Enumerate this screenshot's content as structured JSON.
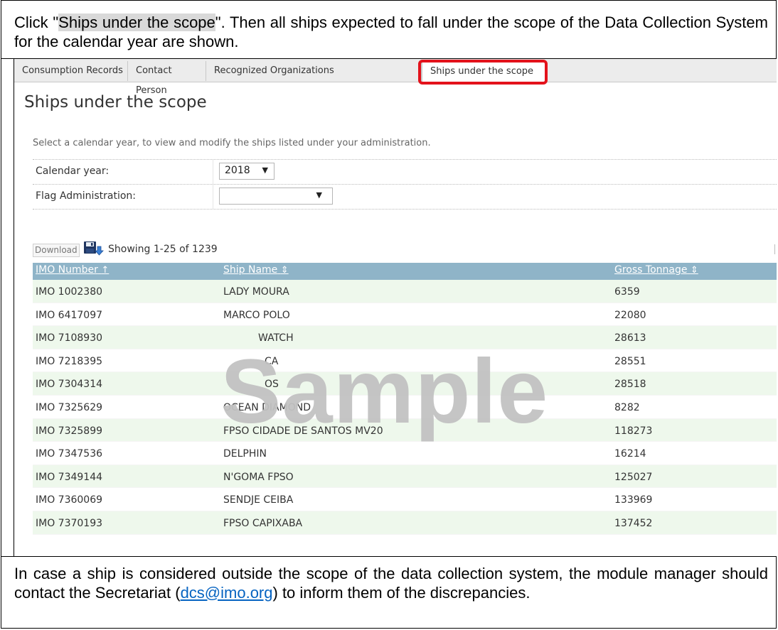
{
  "intro": {
    "prefix": "Click \"",
    "highlight": "Ships under the scope",
    "suffix": "\". Then all ships expected to fall under the scope of the Data Collection System for the calendar year are shown."
  },
  "tabs": [
    {
      "label": "Consumption Records"
    },
    {
      "label": "Contact Person"
    },
    {
      "label": "Recognized Organizations"
    },
    {
      "label": "Ships under the scope",
      "active": true
    }
  ],
  "page": {
    "title": "Ships under the scope",
    "subtitle": "Select a calendar year, to view and modify the ships listed under your administration."
  },
  "form": {
    "calendar_year_label": "Calendar year:",
    "calendar_year_value": "2018",
    "flag_admin_label": "Flag Administration:",
    "flag_admin_value": ""
  },
  "toolbar": {
    "download_label": "Download",
    "download_icon": "save-download-icon",
    "showing_text": "Showing 1-25 of 1239"
  },
  "table": {
    "columns": [
      {
        "label": "IMO Number",
        "sort": "↑"
      },
      {
        "label": "Ship Name",
        "sort": "⇕"
      },
      {
        "label": "Gross Tonnage",
        "sort": "⇕"
      }
    ],
    "rows": [
      [
        "IMO 1002380",
        "LADY MOURA",
        "6359"
      ],
      [
        "IMO 6417097",
        "MARCO POLO",
        "22080"
      ],
      [
        "IMO 7108930",
        "WATCH",
        "28613"
      ],
      [
        "IMO 7218395",
        "CA",
        "28551"
      ],
      [
        "IMO 7304314",
        "OS",
        "28518"
      ],
      [
        "IMO 7325629",
        "OCEAN DIAMOND",
        "8282"
      ],
      [
        "IMO 7325899",
        "FPSO CIDADE DE SANTOS MV20",
        "118273"
      ],
      [
        "IMO 7347536",
        "DELPHIN",
        "16214"
      ],
      [
        "IMO 7349144",
        "N'GOMA FPSO",
        "125027"
      ],
      [
        "IMO 7360069",
        "SENDJE CEIBA",
        "133969"
      ],
      [
        "IMO 7370193",
        "FPSO CAPIXABA",
        "137452"
      ]
    ]
  },
  "watermark": "Sample",
  "outro": {
    "before": "In case a ship is considered outside the scope of the data collection system, the module manager should contact the Secretariat (",
    "email": "dcs@imo.org",
    "after": ") to inform them of the discrepancies."
  },
  "colors": {
    "highlight_box": "#e3121b",
    "table_header": "#8fb4c8",
    "row_alt": "#eef8ec",
    "link": "#0563c1"
  }
}
